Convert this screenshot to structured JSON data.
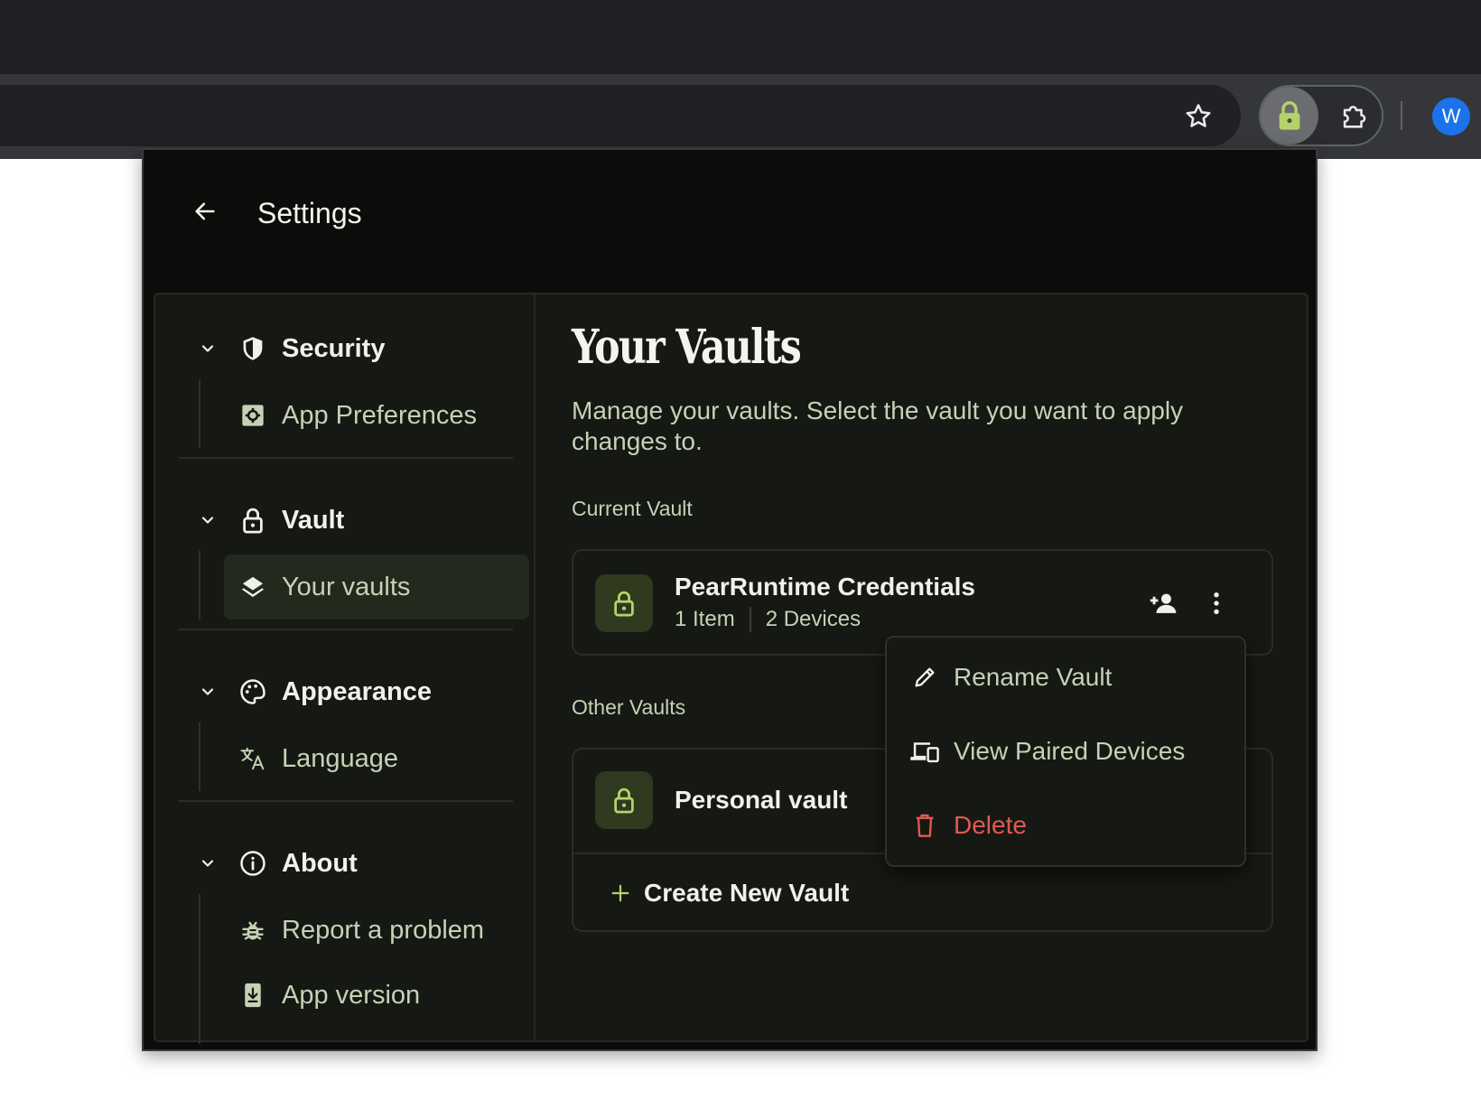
{
  "browser": {
    "profile_initial": "W"
  },
  "header": {
    "title": "Settings"
  },
  "sidebar": {
    "sections": [
      {
        "label": "Security",
        "items": [
          {
            "label": "App Preferences"
          }
        ]
      },
      {
        "label": "Vault",
        "items": [
          {
            "label": "Your vaults"
          }
        ]
      },
      {
        "label": "Appearance",
        "items": [
          {
            "label": "Language"
          }
        ]
      },
      {
        "label": "About",
        "items": [
          {
            "label": "Report a problem"
          },
          {
            "label": "App version"
          }
        ]
      }
    ]
  },
  "main": {
    "title": "Your Vaults",
    "description": "Manage your vaults. Select the vault you want to apply changes to.",
    "current_label": "Current Vault",
    "current_vault": {
      "name": "PearRuntime Credentials",
      "items": "1 Item",
      "devices": "2 Devices"
    },
    "other_label": "Other Vaults",
    "other_vaults": [
      {
        "name": "Personal vault"
      }
    ],
    "create_label": "Create New Vault"
  },
  "context_menu": {
    "items": [
      {
        "label": "Rename Vault",
        "icon": "pencil-icon"
      },
      {
        "label": "View Paired Devices",
        "icon": "devices-icon"
      },
      {
        "label": "Delete",
        "icon": "trash-icon"
      }
    ]
  },
  "colors": {
    "accent": "#b5d36b",
    "danger": "#e05a52",
    "panel": "#161814",
    "active_item": "#24291d"
  }
}
